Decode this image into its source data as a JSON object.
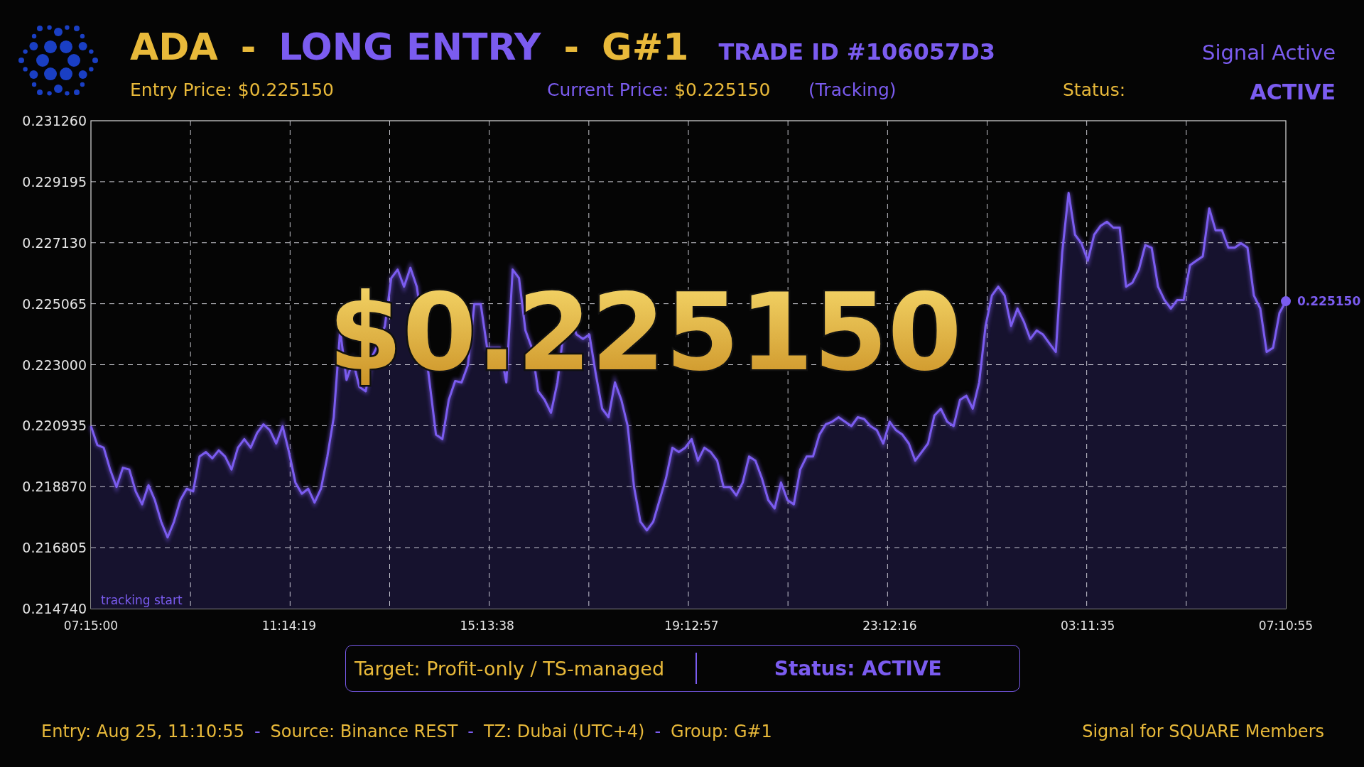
{
  "header": {
    "title_parts": [
      {
        "text": "ADA",
        "color": "#e8b93a"
      },
      {
        "text": "-",
        "color": "#e8b93a"
      },
      {
        "text": "LONG ENTRY",
        "color": "#7b5cf0"
      },
      {
        "text": "-",
        "color": "#e8b93a"
      },
      {
        "text": "G#1",
        "color": "#e8b93a"
      }
    ],
    "trade_id": "TRADE ID #106057D3",
    "signal_state": "Signal Active",
    "entry_price": "Entry Price: $0.225150",
    "current_price_label": "Current Price:",
    "current_price": "$0.225150",
    "tracking": "(Tracking)",
    "status_label": "Status:",
    "status_value": "ACTIVE"
  },
  "chart": {
    "overlay_price": "$0.225150",
    "start_label": "tracking start",
    "end_label": "0.225150",
    "chart_data": {
      "type": "area",
      "grid": true,
      "ylim": [
        0.21474,
        0.23126
      ],
      "categories": [
        "07:15:00",
        null,
        null,
        null,
        null,
        null,
        null,
        null,
        null,
        null,
        null,
        null,
        null,
        null,
        null,
        null,
        null,
        null,
        null,
        null,
        null,
        null,
        null,
        null,
        null,
        null,
        null,
        null,
        null,
        null,
        null,
        "11:14:19",
        null,
        null,
        null,
        null,
        null,
        null,
        null,
        null,
        null,
        null,
        null,
        null,
        null,
        null,
        null,
        null,
        null,
        null,
        null,
        null,
        null,
        null,
        null,
        null,
        null,
        null,
        null,
        null,
        null,
        null,
        "15:13:38",
        null,
        null,
        null,
        null,
        null,
        null,
        null,
        null,
        null,
        null,
        null,
        null,
        null,
        null,
        null,
        null,
        null,
        null,
        null,
        null,
        null,
        null,
        null,
        null,
        null,
        null,
        null,
        null,
        null,
        null,
        null,
        "19:12:57",
        null,
        null,
        null,
        null,
        null,
        null,
        null,
        null,
        null,
        null,
        null,
        null,
        null,
        null,
        null,
        null,
        null,
        null,
        null,
        null,
        null,
        null,
        null,
        null,
        null,
        null,
        null,
        null,
        null,
        null,
        "23:12:16",
        null,
        null,
        null,
        null,
        null,
        null,
        null,
        null,
        null,
        null,
        null,
        null,
        null,
        null,
        null,
        null,
        null,
        null,
        null,
        null,
        null,
        null,
        null,
        null,
        null,
        null,
        null,
        null,
        null,
        null,
        "03:11:35",
        null,
        null,
        null,
        null,
        null,
        null,
        null,
        null,
        null,
        null,
        null,
        null,
        null,
        null,
        null,
        null,
        null,
        null,
        null,
        null,
        null,
        null,
        null,
        null,
        null,
        null,
        null,
        null,
        null,
        null,
        "07:10:55"
      ],
      "yticks": [
        {
          "value": 0.21474,
          "label": "0.214740"
        },
        {
          "value": 0.216805,
          "label": "0.216805"
        },
        {
          "value": 0.21887,
          "label": "0.218870"
        },
        {
          "value": 0.220935,
          "label": "0.220935"
        },
        {
          "value": 0.223,
          "label": "0.223000"
        },
        {
          "value": 0.225065,
          "label": "0.225065"
        },
        {
          "value": 0.22713,
          "label": "0.227130"
        },
        {
          "value": 0.229195,
          "label": "0.229195"
        },
        {
          "value": 0.23126,
          "label": "0.231260"
        }
      ],
      "series": [
        {
          "color": "#7b5cf0",
          "values": [
            0.22092,
            0.22028,
            0.22019,
            0.21945,
            0.21886,
            0.21951,
            0.21945,
            0.21871,
            0.21827,
            0.21892,
            0.21842,
            0.21768,
            0.21715,
            0.21768,
            0.21842,
            0.2188,
            0.21871,
            0.21989,
            0.22004,
            0.21983,
            0.2201,
            0.21989,
            0.21945,
            0.22019,
            0.22048,
            0.22019,
            0.22069,
            0.22098,
            0.22078,
            0.22033,
            0.22092,
            0.22004,
            0.21901,
            0.21863,
            0.2188,
            0.21833,
            0.2188,
            0.21989,
            0.22122,
            0.22416,
            0.22248,
            0.22313,
            0.22225,
            0.2221,
            0.22328,
            0.22372,
            0.22431,
            0.22593,
            0.22622,
            0.22564,
            0.22628,
            0.22564,
            0.22416,
            0.2224,
            0.22063,
            0.22048,
            0.22181,
            0.22245,
            0.2224,
            0.22299,
            0.22505,
            0.22505,
            0.22357,
            0.22357,
            0.22357,
            0.2224,
            0.22622,
            0.22593,
            0.22416,
            0.22357,
            0.2221,
            0.22181,
            0.22137,
            0.2224,
            0.22416,
            0.22455,
            0.22402,
            0.22387,
            0.22402,
            0.22269,
            0.22151,
            0.22122,
            0.2224,
            0.22181,
            0.22092,
            0.21886,
            0.21768,
            0.21739,
            0.21768,
            0.21842,
            0.21916,
            0.22019,
            0.22004,
            0.22019,
            0.22048,
            0.21975,
            0.22019,
            0.22004,
            0.21975,
            0.21886,
            0.21886,
            0.21857,
            0.21901,
            0.21989,
            0.21975,
            0.21916,
            0.21842,
            0.21813,
            0.21901,
            0.21842,
            0.21827,
            0.21945,
            0.21989,
            0.21989,
            0.22063,
            0.22098,
            0.22107,
            0.22122,
            0.22107,
            0.22092,
            0.22122,
            0.22116,
            0.22092,
            0.22078,
            0.22033,
            0.22107,
            0.22078,
            0.22063,
            0.22033,
            0.21975,
            0.22004,
            0.22033,
            0.22128,
            0.22151,
            0.22107,
            0.22092,
            0.22181,
            0.22195,
            0.22151,
            0.2224,
            0.22431,
            0.22534,
            0.22564,
            0.22534,
            0.22431,
            0.2249,
            0.22446,
            0.22387,
            0.22416,
            0.22402,
            0.22372,
            0.22343,
            0.22681,
            0.22882,
            0.2274,
            0.22711,
            0.22652,
            0.2274,
            0.2277,
            0.22784,
            0.22764,
            0.22764,
            0.22564,
            0.22578,
            0.22622,
            0.22705,
            0.22696,
            0.22564,
            0.22519,
            0.2249,
            0.22519,
            0.22519,
            0.22637,
            0.22652,
            0.22667,
            0.22829,
            0.22755,
            0.22755,
            0.22696,
            0.22696,
            0.22711,
            0.22696,
            0.22534,
            0.2249,
            0.22343,
            0.22357,
            0.22475,
            0.22515
          ]
        }
      ]
    }
  },
  "target_panel": {
    "target": "Target: Profit-only / TS-managed",
    "status": "Status: ACTIVE"
  },
  "footer": {
    "parts": [
      {
        "text": "Entry: Aug 25, 11:10:55",
        "color": "#e8b93a"
      },
      {
        "text": "-",
        "color": "#7b5cf0"
      },
      {
        "text": "Source: Binance REST",
        "color": "#e8b93a"
      },
      {
        "text": "-",
        "color": "#7b5cf0"
      },
      {
        "text": "TZ: Dubai (UTC+4)",
        "color": "#e8b93a"
      },
      {
        "text": "-",
        "color": "#7b5cf0"
      },
      {
        "text": "Group: G#1",
        "color": "#e8b93a"
      }
    ],
    "right": "Signal for SQUARE Members"
  }
}
